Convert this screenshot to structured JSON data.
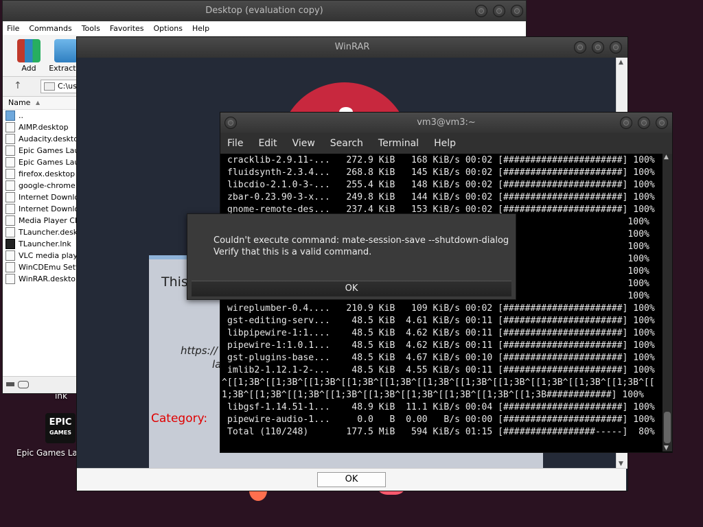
{
  "desktop": {
    "icons": [
      {
        "label": "lnk"
      },
      {
        "label": "Epic Games La"
      }
    ],
    "epic_logo_lines": [
      "EPIC",
      "GAMES"
    ]
  },
  "explorer": {
    "title": "Desktop (evaluation copy)",
    "menu": [
      "File",
      "Commands",
      "Tools",
      "Favorites",
      "Options",
      "Help"
    ],
    "toolbar": {
      "add": "Add",
      "extract": "Extract T"
    },
    "address": "C:\\us",
    "column_name": "Name",
    "files": [
      "..",
      "AIMP.desktop",
      "Audacity.desktop",
      "Epic Games Laun...",
      "Epic Games Laun...",
      "firefox.desktop",
      "google-chrome.d...",
      "Internet Downloa...",
      "Internet Downloa...",
      "Media Player Cla...",
      "TLauncher.deskt...",
      "TLauncher.lnk",
      "VLC media player...",
      "WinCDEmu Settin...",
      "WinRAR.desktop"
    ]
  },
  "winrar": {
    "title": "WinRAR",
    "partial_text": "This",
    "partial_link": "https://",
    "partial_link2": "la",
    "category_label": "Category:",
    "ok_label": "OK"
  },
  "terminal": {
    "title": "vm3@vm3:~",
    "menu": [
      "File",
      "Edit",
      "View",
      "Search",
      "Terminal",
      "Help"
    ],
    "lines": [
      "cracklib-2.9.11-...   272.9 KiB   168 KiB/s 00:02 [######################] 100%",
      "fluidsynth-2.3.4...   268.8 KiB   145 KiB/s 00:02 [######################] 100%",
      "libcdio-2.1.0-3-...   255.4 KiB   148 KiB/s 00:02 [######################] 100%",
      "zbar-0.23.90-3-x...   249.8 KiB   144 KiB/s 00:02 [######################] 100%",
      "gnome-remote-des...   237.4 KiB   153 KiB/s 00:02 [######################] 100%",
      "                                                                          100%",
      "                                                                          100%",
      "                                                                          100%",
      "                                                                          100%",
      "                                                                          100%",
      "                                                                          100%",
      "                                                                          100%",
      "wireplumber-0.4....   210.9 KiB   109 KiB/s 00:02 [######################] 100%",
      "gst-editing-serv...    48.5 KiB  4.61 KiB/s 00:11 [######################] 100%",
      "libpipewire-1:1....    48.5 KiB  4.62 KiB/s 00:11 [######################] 100%",
      "pipewire-1:1.0.1...    48.5 KiB  4.62 KiB/s 00:11 [######################] 100%",
      "gst-plugins-base...    48.5 KiB  4.67 KiB/s 00:10 [######################] 100%",
      "imlib2-1.12.1-2-...    48.5 KiB  4.55 KiB/s 00:11 [######################] 100%",
      "^[[1;3B^[[1;3B^[[1;3B^[[1;3B^[[1;3B^[[1;3B^[[1;3B^[[1;3B^[[1;3B^[[1;3B^[[1;3B^[[",
      "1;3B^[[1;3B^[[1;3B^[[1;3B^[[1;3B^[[1;3B^[[1;3B^[[1;3B^[[1;3B############] 100%",
      "libgsf-1.14.51-1...    48.9 KiB  11.1 KiB/s 00:04 [######################] 100%",
      "pipewire-audio-1...     0.0   B  0.00   B/s 00:00 [######################] 100%",
      "Total (110/248)       177.5 MiB   594 KiB/s 01:15 [#################-----]  80%"
    ]
  },
  "error_dialog": {
    "line1": "Couldn't execute command: mate-session-save --shutdown-dialog",
    "line2": "Verify that this is a valid command.",
    "ok_label": "OK"
  }
}
